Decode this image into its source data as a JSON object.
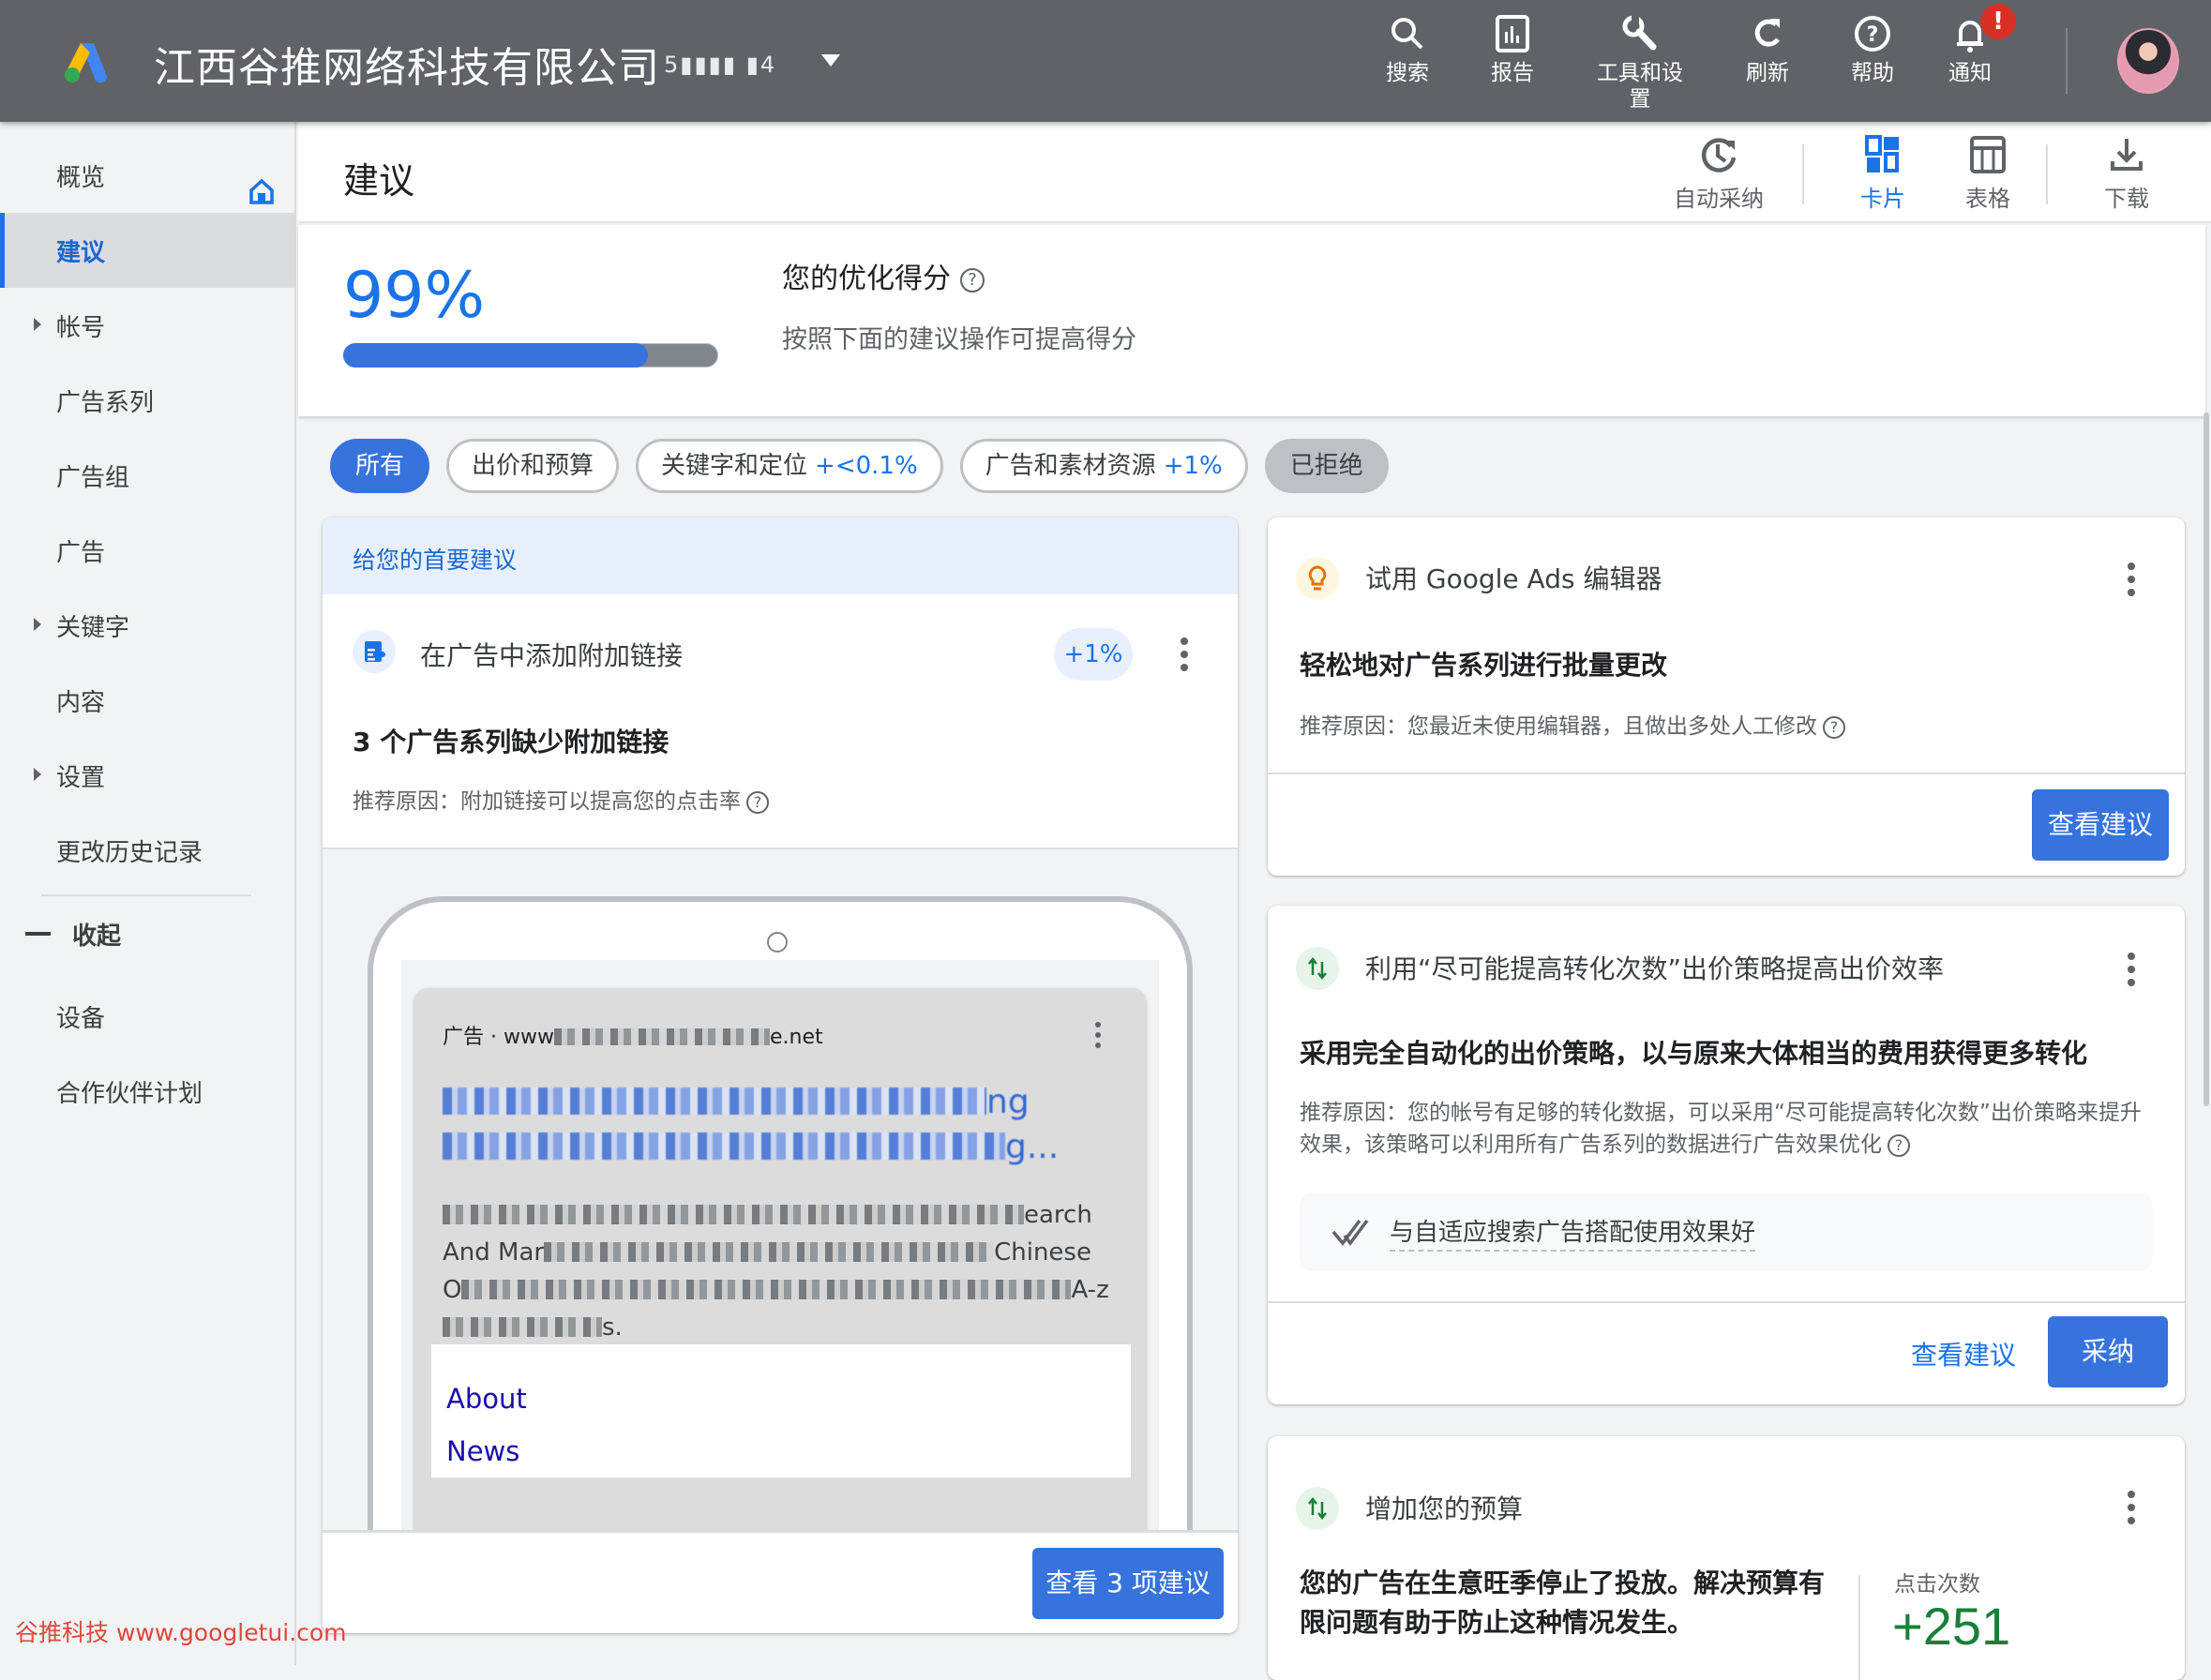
{
  "topbar": {
    "account_name": "江西谷推网络科技有限公司",
    "account_id": "5▮▮▮▮  ▮4",
    "actions": [
      {
        "label": "搜索",
        "icon": "search-icon"
      },
      {
        "label": "报告",
        "icon": "reports-icon"
      },
      {
        "label": "工具和设置",
        "icon": "wrench-icon"
      },
      {
        "label": "刷新",
        "icon": "refresh-icon"
      },
      {
        "label": "帮助",
        "icon": "help-icon"
      },
      {
        "label": "通知",
        "icon": "bell-icon",
        "badge": "!"
      }
    ]
  },
  "sidebar": {
    "items": [
      {
        "label": "概览",
        "icon": "home-icon"
      },
      {
        "label": "建议",
        "active": true
      },
      {
        "label": "帐号",
        "expandable": true
      },
      {
        "label": "广告系列"
      },
      {
        "label": "广告组"
      },
      {
        "label": "广告"
      },
      {
        "label": "关键字",
        "expandable": true
      },
      {
        "label": "内容"
      },
      {
        "label": "设置",
        "expandable": true
      },
      {
        "label": "更改历史记录"
      }
    ],
    "collapse_label": "收起",
    "extra_items": [
      {
        "label": "设备"
      },
      {
        "label": "合作伙伴计划"
      }
    ]
  },
  "page": {
    "title": "建议",
    "view_actions": [
      {
        "label": "自动采纳",
        "icon": "auto-apply-icon"
      },
      {
        "label": "卡片",
        "icon": "cards-icon",
        "active": true
      },
      {
        "label": "表格",
        "icon": "table-icon"
      },
      {
        "label": "下载",
        "icon": "download-icon"
      }
    ]
  },
  "score": {
    "value": "99%",
    "progress_percent": 99,
    "title": "您的优化得分",
    "subtitle": "按照下面的建议操作可提高得分"
  },
  "filters": [
    {
      "label": "所有",
      "active": true
    },
    {
      "label": "出价和预算"
    },
    {
      "label": "关键字和定位",
      "delta": "+<0.1%"
    },
    {
      "label": "广告和素材资源",
      "delta": "+1%"
    },
    {
      "label": "已拒绝",
      "rejected": true
    }
  ],
  "top_card": {
    "banner": "给您的首要建议",
    "title": "在广告中添加附加链接",
    "delta": "+1%",
    "headline": "3 个广告系列缺少附加链接",
    "reason": "推荐原因：附加链接可以提高您的点击率",
    "ad_preview": {
      "label": "广告 · www",
      "domain_tail": "e.net",
      "headline_tail_1": "ng",
      "headline_tail_2": "g...",
      "desc_1_tail": "earch",
      "desc_2_head": "And Mar",
      "desc_2_tail": "Chinese",
      "desc_3_head": "O",
      "desc_3_tail": "A-z",
      "desc_4_tail": "s.",
      "sitelinks": [
        "About",
        "News"
      ]
    },
    "button": "查看 3 项建议"
  },
  "cards": [
    {
      "title": "试用 Google Ads 编辑器",
      "icon": "lightbulb-icon",
      "headline": "轻松地对广告系列进行批量更改",
      "reason": "推荐原因：您最近未使用编辑器，且做出多处人工修改",
      "primary_button": "查看建议"
    },
    {
      "title": "利用“尽可能提高转化次数”出价策略提高出价效率",
      "icon": "bidding-arrows-icon",
      "headline": "采用完全自动化的出价策略，以与原来大体相当的费用获得更多转化",
      "reason": "推荐原因：您的帐号有足够的转化数据，可以采用“尽可能提高转化次数”出价策略来提升效果，该策略可以利用所有广告系列的数据进行广告效果优化",
      "note": "与自适应搜索广告搭配使用效果好",
      "secondary_button": "查看建议",
      "primary_button": "采纳"
    },
    {
      "title": "增加您的预算",
      "icon": "bidding-arrows-icon",
      "headline": "您的广告在生意旺季停止了投放。解决预算有限问题有助于防止这种情况发生。",
      "metric_label": "点击次数",
      "metric_value": "+251"
    }
  ],
  "watermark": "谷推科技 www.googletui.com",
  "colors": {
    "accent": "#1a73e8",
    "topbar": "#5f6368",
    "positive": "#188038",
    "badge": "#d93025"
  }
}
